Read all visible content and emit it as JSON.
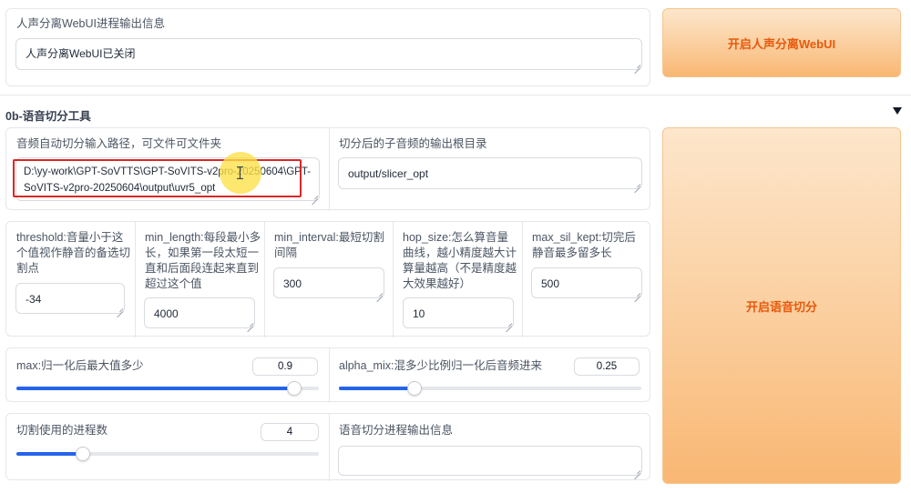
{
  "top_section": {
    "uvr_output_label": "人声分离WebUI进程输出信息",
    "uvr_output_value": "人声分离WebUI已关闭",
    "open_uvr_button": "开启人声分离WebUI"
  },
  "slicer_section": {
    "title": "0b-语音切分工具",
    "collapse_icon": "triangle-down-icon",
    "input_path_label": "音频自动切分输入路径，可文件可文件夹",
    "input_path_value": "D:\\yy-work\\GPT-SoVTTS\\GPT-SoVITS-v2pro-20250604\\GPT-SoVITS-v2pro-20250604\\output\\uvr5_opt",
    "output_root_label": "切分后的子音频的输出根目录",
    "output_root_value": "output/slicer_opt",
    "params": [
      {
        "label": "threshold:音量小于这个值视作静音的备选切割点",
        "value": "-34"
      },
      {
        "label": "min_length:每段最小多长，如果第一段太短一直和后面段连起来直到超过这个值",
        "value": "4000"
      },
      {
        "label": "min_interval:最短切割间隔",
        "value": "300"
      },
      {
        "label": "hop_size:怎么算音量曲线，越小精度越大计算量越高（不是精度越大效果越好）",
        "value": "10"
      },
      {
        "label": "max_sil_kept:切完后静音最多留多长",
        "value": "500"
      }
    ],
    "max_slider": {
      "label": "max:归一化后最大值多少",
      "value": "0.9",
      "fraction": 0.92
    },
    "alpha_slider": {
      "label": "alpha_mix:混多少比例归一化后音频进来",
      "value": "0.25",
      "fraction": 0.25
    },
    "procs_slider": {
      "label": "切割使用的进程数",
      "value": "4",
      "fraction": 0.22
    },
    "slicer_output_label": "语音切分进程输出信息",
    "slicer_output_value": "",
    "open_slicer_button": "开启语音切分"
  },
  "colors": {
    "accent": "#2563eb",
    "button_text": "#e8590c",
    "highlight_border": "#dc2626",
    "cursor_highlight": "#fde047"
  }
}
